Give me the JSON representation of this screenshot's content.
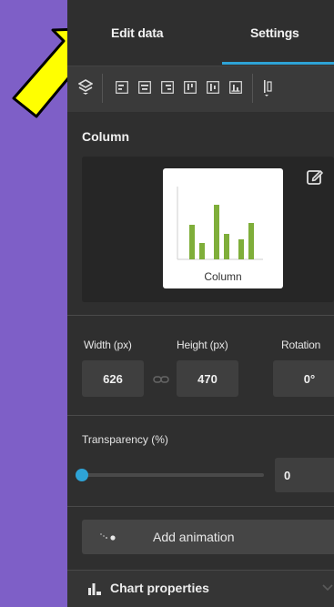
{
  "tabs": [
    {
      "label": "Edit data",
      "active": false
    },
    {
      "label": "Settings",
      "active": true
    }
  ],
  "toolbar": {
    "icons": [
      "layers-icon",
      "align-left-icon",
      "align-center-icon",
      "align-right-icon",
      "align-top-icon",
      "align-middle-icon",
      "align-bottom-icon",
      "distribute-icon"
    ]
  },
  "section": {
    "label": "Column",
    "thumbnail_label": "Column"
  },
  "dimensions": {
    "width_label": "Width (px)",
    "height_label": "Height (px)",
    "rotation_label": "Rotation",
    "width_value": "626",
    "height_value": "470",
    "rotation_value": "0°"
  },
  "transparency": {
    "label": "Transparency (%)",
    "value": "0"
  },
  "animation": {
    "label": "Add animation"
  },
  "chart_properties": {
    "label": "Chart properties"
  },
  "colors": {
    "accent": "#2ea3d6",
    "background": "#7e5fc7",
    "panel": "#2f2f2f",
    "arrow": "#ffff00",
    "chart_bars": "#7fae3a"
  }
}
